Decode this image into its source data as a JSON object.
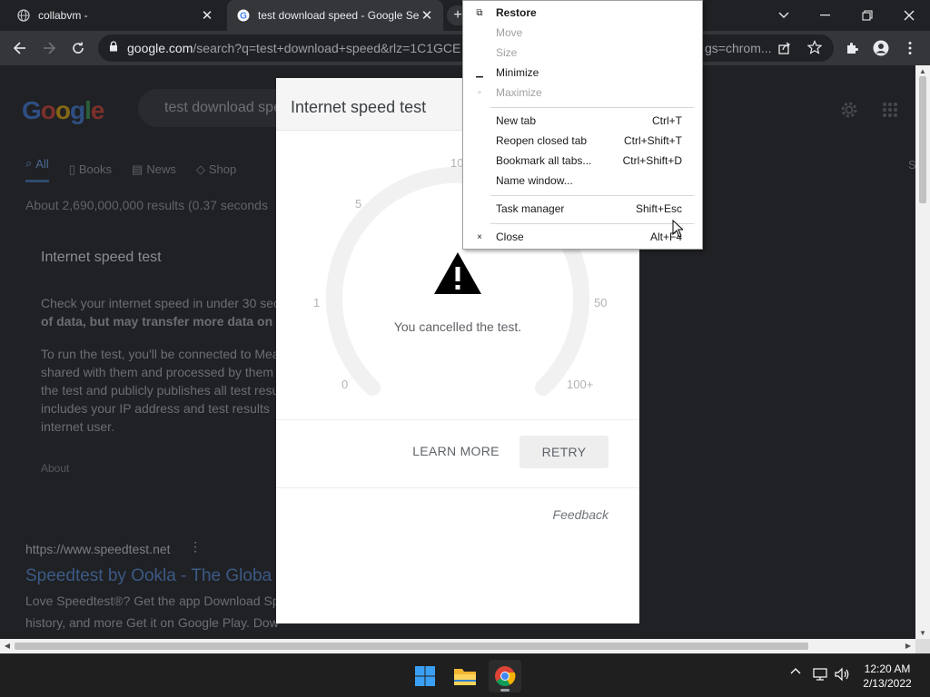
{
  "browser": {
    "tabs": [
      {
        "title": "collabvm -",
        "favicon": "globe-icon"
      },
      {
        "title": "test download speed - Google Se",
        "favicon": "google-g-icon",
        "active": true
      }
    ],
    "url_host": "google.com",
    "url_path": "/search?q=test+download+speed&rlz=1C1GCE",
    "url_tail": "gs=chrom...",
    "page_zoom_note": ""
  },
  "google": {
    "logo": [
      "G",
      "o",
      "o",
      "g",
      "l",
      "e"
    ],
    "query": "test download spe",
    "tabs": [
      {
        "label": "All",
        "icon": "search-icon"
      },
      {
        "label": "Books",
        "icon": "book-icon"
      },
      {
        "label": "News",
        "icon": "news-icon"
      },
      {
        "label": "Shop",
        "icon": "tag-icon"
      }
    ],
    "results_count": "About 2,690,000,000 results (0.37 seconds",
    "card_title": "Internet speed test",
    "para1_line1": "Check your internet speed in under 30 sec",
    "para1_line2": "of data, but may transfer more data on fas",
    "para2": [
      "To run the test, you'll be connected to Mea",
      "shared with them and processed by them",
      "the test and publicly publishes all test resu",
      "includes your IP address and test results",
      "internet user."
    ],
    "about": "About",
    "result_url": "https://www.speedtest.net",
    "result_title": "Speedtest by Ookla - The Globa",
    "result_snippet1": "Love Speedtest®? Get the app Download Sp",
    "result_snippet2": "history, and more Get it on Google Play. Dow",
    "right_edge_letter": "S"
  },
  "speedtest": {
    "title": "Internet speed test",
    "gauge_labels": {
      "l0": "0",
      "l1": "1",
      "l5": "5",
      "l10": "10",
      "l50": "50",
      "l100": "100+"
    },
    "message": "You cancelled the test.",
    "learn_more": "LEARN MORE",
    "retry": "RETRY",
    "feedback": "Feedback"
  },
  "context_menu": {
    "items": [
      {
        "label": "Restore",
        "icon": "restore-icon",
        "shortcut": "",
        "enabled": true,
        "bold": true
      },
      {
        "label": "Move",
        "icon": "",
        "shortcut": "",
        "enabled": false
      },
      {
        "label": "Size",
        "icon": "",
        "shortcut": "",
        "enabled": false
      },
      {
        "label": "Minimize",
        "icon": "minimize-icon",
        "shortcut": "",
        "enabled": true
      },
      {
        "label": "Maximize",
        "icon": "maximize-icon",
        "shortcut": "",
        "enabled": false
      },
      {
        "label": "New tab",
        "shortcut": "Ctrl+T",
        "enabled": true
      },
      {
        "label": "Reopen closed tab",
        "shortcut": "Ctrl+Shift+T",
        "enabled": true
      },
      {
        "label": "Bookmark all tabs...",
        "shortcut": "Ctrl+Shift+D",
        "enabled": true
      },
      {
        "label": "Name window...",
        "shortcut": "",
        "enabled": true
      },
      {
        "label": "Task manager",
        "shortcut": "Shift+Esc",
        "enabled": true
      },
      {
        "label": "Close",
        "icon": "close-icon",
        "shortcut": "Alt+F4",
        "enabled": true
      }
    ]
  },
  "taskbar": {
    "apps": [
      "windows-start-icon",
      "file-explorer-icon",
      "chrome-icon"
    ],
    "time": "12:20 AM",
    "date": "2/13/2022"
  },
  "colors": {
    "chrome_dark": "#202124",
    "toolbar": "#35363a",
    "taskbar": "#1f1f1f"
  }
}
